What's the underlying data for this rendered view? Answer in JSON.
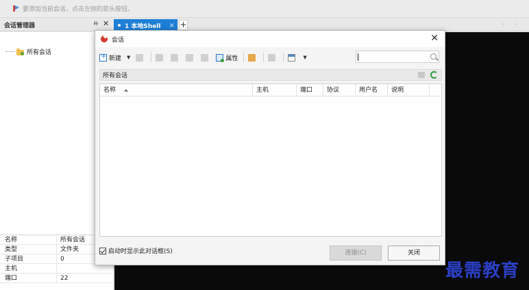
{
  "hint_bar": {
    "text": "要添加当前会话，点击左侧的箭头按钮。"
  },
  "tabs": {
    "session_manager_title": "会话管理器",
    "pin_glyph": "ᵰ",
    "close_glyph": "✕",
    "active_tab_label": "1 本地Shell",
    "active_tab_close": "×",
    "add_tab": "+",
    "nav_arrows": "‹ ›"
  },
  "tree": {
    "root_label": "所有会话"
  },
  "properties": [
    {
      "key": "名称",
      "value": "所有会话"
    },
    {
      "key": "类型",
      "value": "文件夹"
    },
    {
      "key": "子项目",
      "value": "0"
    },
    {
      "key": "主机",
      "value": ""
    },
    {
      "key": "端口",
      "value": "22"
    }
  ],
  "dialog": {
    "title": "会话",
    "close_glyph": "✕",
    "toolbar": {
      "new_label": "新建",
      "properties_label": "属性",
      "dropdown_glyph": "▼"
    },
    "search": {
      "value": ""
    },
    "path": "所有会话",
    "columns": [
      {
        "key": "name",
        "label": "名称"
      },
      {
        "key": "host",
        "label": "主机"
      },
      {
        "key": "port",
        "label": "端口"
      },
      {
        "key": "protocol",
        "label": "协议"
      },
      {
        "key": "username",
        "label": "用户名"
      },
      {
        "key": "description",
        "label": "说明"
      }
    ],
    "rows": [],
    "startup_checkbox_label": "启动时显示此对话框(S)",
    "startup_checked": true,
    "connect_button": "连接(C)",
    "close_button": "关闭"
  },
  "watermark": "最需教育",
  "colors": {
    "tab_active": "#1e7fd6",
    "terminal_bg": "#0a0a0a",
    "watermark": "#2b3fc4",
    "refresh": "#2f9a43"
  }
}
